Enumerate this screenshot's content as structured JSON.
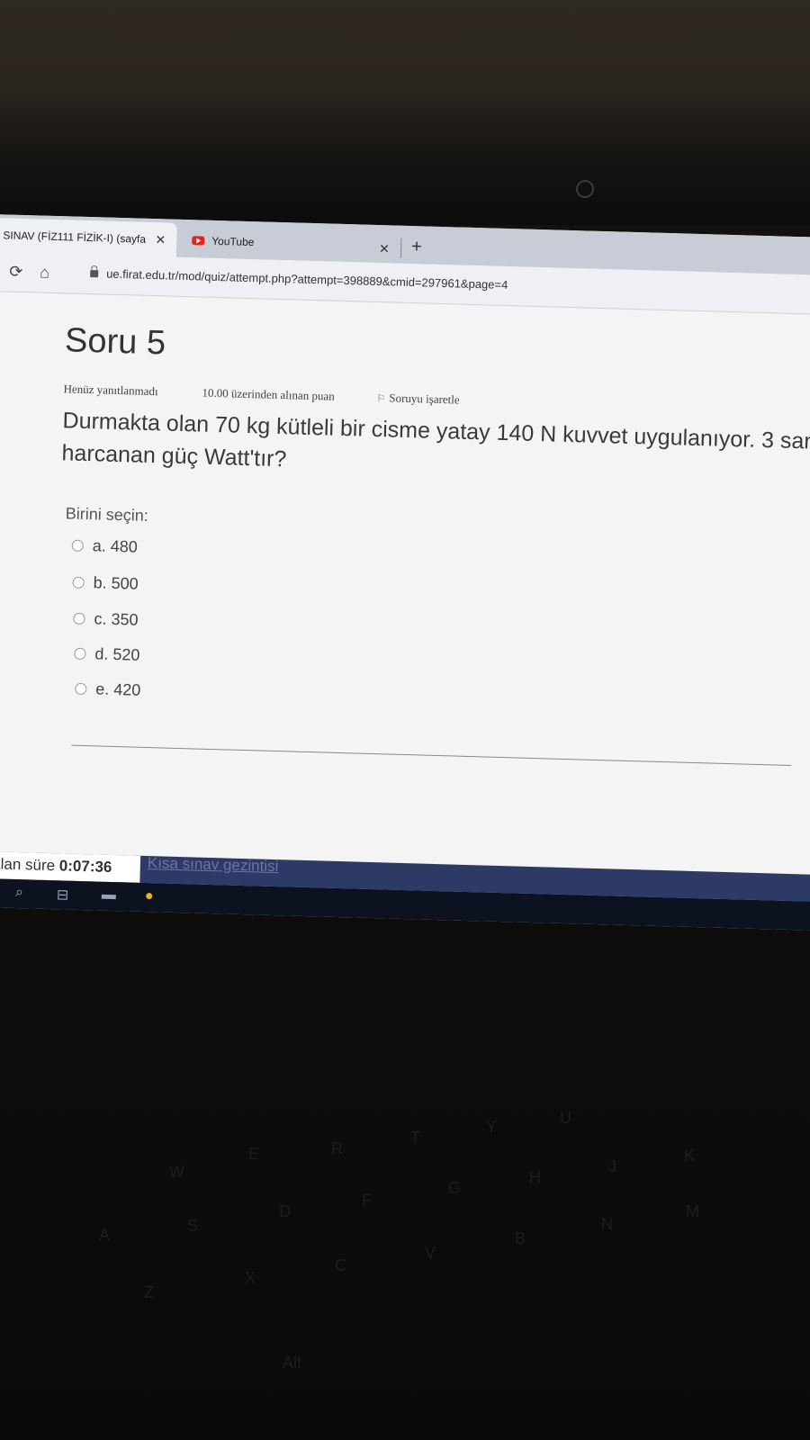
{
  "browser": {
    "tabs": [
      {
        "label": "SINAV (FİZ111 FİZİK-I) (sayfa",
        "close": "✕"
      },
      {
        "label": "YouTube",
        "close": "✕"
      }
    ],
    "new_tab": "+",
    "url": "ue.firat.edu.tr/mod/quiz/attempt.php?attempt=398889&cmid=297961&page=4"
  },
  "question": {
    "title": "Soru 5",
    "status": "Henüz yanıtlanmadı",
    "points": "10.00 üzerinden alınan puan",
    "flag": "Soruyu işaretle",
    "text_line1": "Durmakta olan 70 kg kütleli bir cisme yatay 140 N kuvvet uygulanıyor. 3 san",
    "text_line2": "harcanan güç Watt'tır?",
    "choose_label": "Birini seçin:",
    "options": [
      {
        "label": "a. 480"
      },
      {
        "label": "b. 500"
      },
      {
        "label": "c. 350"
      },
      {
        "label": "d. 520"
      },
      {
        "label": "e. 420"
      }
    ]
  },
  "footer": {
    "timer_label": "Kalan süre",
    "timer_value": "0:07:36",
    "quiz_nav": "Kısa sınav gezintisi"
  },
  "keyboard_keys": [
    "W",
    "E",
    "R",
    "T",
    "Y",
    "U",
    "A",
    "S",
    "D",
    "F",
    "G",
    "H",
    "J",
    "K",
    "Z",
    "X",
    "C",
    "V",
    "B",
    "N",
    "M",
    "Alt"
  ]
}
